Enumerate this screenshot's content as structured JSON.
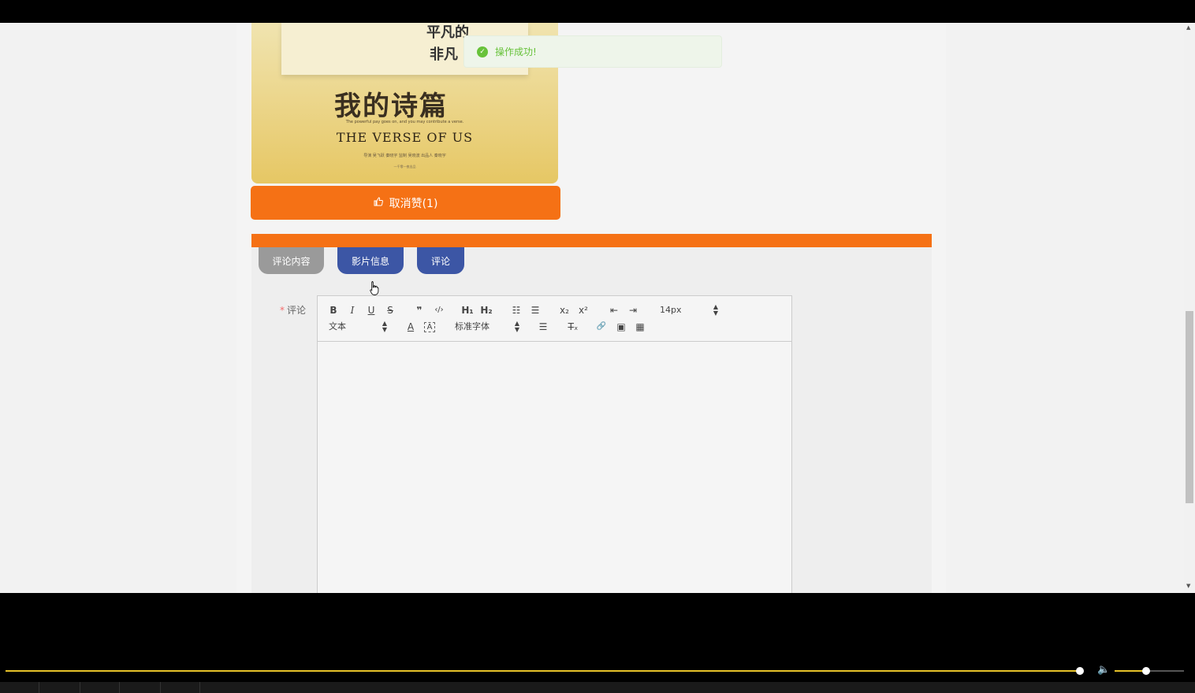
{
  "toast": {
    "message": "操作成功!",
    "icon": "check-circle-icon",
    "color": "#67c23a"
  },
  "poster": {
    "scribble_line1": "平凡的",
    "scribble_line2": "非凡",
    "cn_title": "我的诗篇",
    "tagline": "The powerful pay goes on, and you may contribute a verse.",
    "en_title": "THE VERSE OF US",
    "credits": "导演 吴飞跃 秦晓宇    监制 吴晓波    出品人 秦晓宇",
    "fine_print": "一千零一夜出品"
  },
  "like_button": {
    "label": "取消赞(1)",
    "icon": "thumbs-up-icon"
  },
  "tabs": [
    {
      "label": "评论内容"
    },
    {
      "label": "影片信息"
    },
    {
      "label": "评论"
    }
  ],
  "form": {
    "required_mark": "*",
    "comment_label": "评论"
  },
  "editor": {
    "size_select": "14px",
    "header_select": "文本",
    "font_select": "标准字体",
    "buttons": {
      "bold": "B",
      "italic": "I",
      "underline": "U",
      "strike": "S",
      "blockquote": "❞",
      "code": "‹/›",
      "h1": "H₁",
      "h2": "H₂",
      "ordered_list": "☷",
      "bullet_list": "☰",
      "sub": "x₂",
      "sup": "x²",
      "outdent": "⇤",
      "indent": "⇥",
      "color": "A",
      "background": "A",
      "align": "☰",
      "clean": "T̶ₓ",
      "link": "🔗",
      "image": "▣",
      "video": "▦"
    }
  },
  "colors": {
    "accent": "#f57115",
    "tab_active": "#3c56a5",
    "tab_inactive": "#9a9a9a",
    "progress": "#e6c229"
  },
  "player": {
    "progress": 0.998,
    "volume": 0.45
  }
}
